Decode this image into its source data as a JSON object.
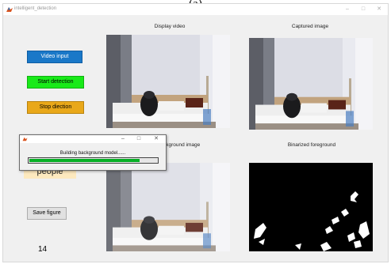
{
  "caption": "(a)",
  "window": {
    "title": "intelligent_detection",
    "minimize": "–",
    "maximize": "□",
    "close": "✕"
  },
  "buttons": {
    "video_input": "Video input",
    "start_detection": "Start detection",
    "stop_detection": "Stop diection",
    "save_figure": "Save figure"
  },
  "people_label": "people",
  "counter": "14",
  "panels": {
    "display_title": "Display video",
    "captured_title": "Captured image",
    "background_title": "ckground image",
    "binarized_title": "Binarized foreground"
  },
  "dialog": {
    "message": "Building background model......",
    "progress": 0.85,
    "minimize": "–",
    "maximize": "□",
    "close": "✕"
  },
  "colors": {
    "video_btn": "#1a78c8",
    "start_btn": "#19ea19",
    "stop_btn": "#e9a81a",
    "progress": "#06b025"
  },
  "icons": [
    "matlab-icon",
    "minimize-icon",
    "maximize-icon",
    "close-icon"
  ]
}
